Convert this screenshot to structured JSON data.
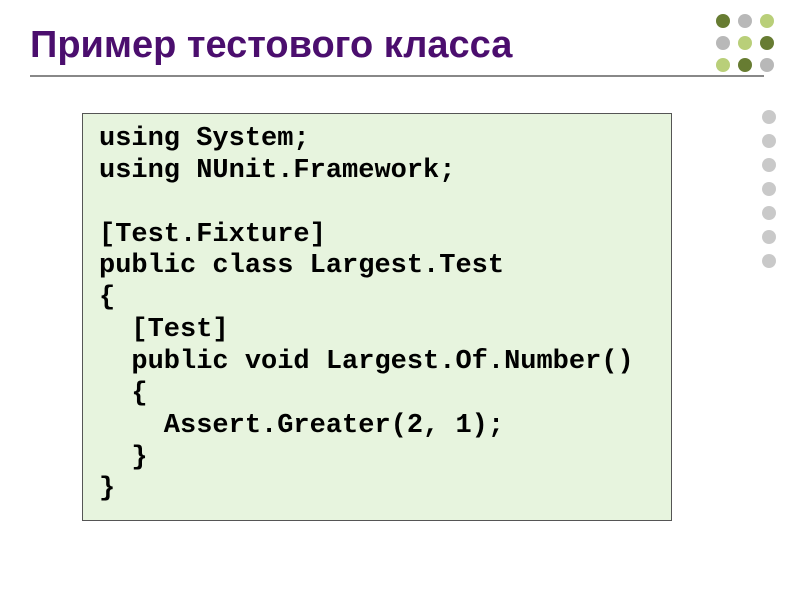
{
  "title": "Пример тестового класса",
  "code": "using System;\nusing NUnit.Framework;\n\n[Test.Fixture]\npublic class Largest.Test\n{\n  [Test]\n  public void Largest.Of.Number()\n  {\n    Assert.Greater(2, 1);\n  }\n}"
}
